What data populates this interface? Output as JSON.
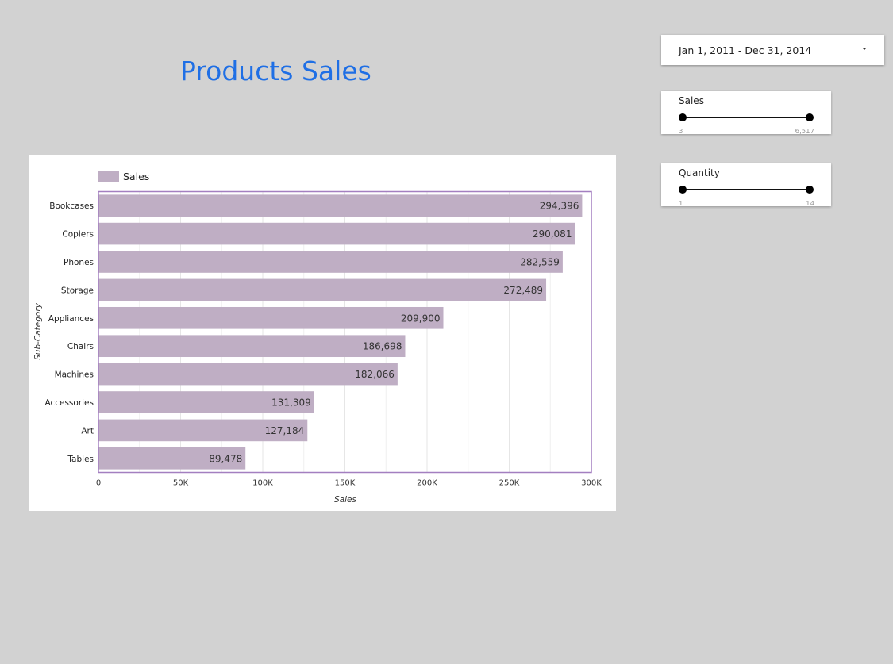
{
  "page": {
    "title": "Products Sales"
  },
  "date_range": {
    "label": "Jan 1, 2011 - Dec 31, 2014"
  },
  "sales_filter": {
    "title": "Sales",
    "min_label": "3",
    "max_label": "6,517"
  },
  "quantity_filter": {
    "title": "Quantity",
    "min_label": "1",
    "max_label": "14"
  },
  "icons": {
    "date_dropdown": "caret-down-icon"
  },
  "colors": {
    "title": "#1f6fe5",
    "bar": "#bfaec4",
    "plot_border": "#a37fc0",
    "background": "#d2d2d2"
  },
  "chart_data": {
    "type": "bar",
    "orientation": "horizontal",
    "categories": [
      "Bookcases",
      "Copiers",
      "Phones",
      "Storage",
      "Appliances",
      "Chairs",
      "Machines",
      "Accessories",
      "Art",
      "Tables"
    ],
    "series": [
      {
        "name": "Sales",
        "values": [
          294396,
          290081,
          282559,
          272489,
          209900,
          186698,
          182066,
          131309,
          127184,
          89478
        ],
        "value_labels": [
          "294,396",
          "290,081",
          "282,559",
          "272,489",
          "209,900",
          "186,698",
          "182,066",
          "131,309",
          "127,184",
          "89,478"
        ]
      }
    ],
    "xlabel": "Sales",
    "ylabel": "Sub-Category",
    "xlim": [
      0,
      300000
    ],
    "xticks": [
      0,
      50000,
      100000,
      150000,
      200000,
      250000,
      300000
    ],
    "xtick_labels": [
      "0",
      "50K",
      "100K",
      "150K",
      "200K",
      "250K",
      "300K"
    ],
    "grid": true,
    "legend_position": "top-left"
  }
}
